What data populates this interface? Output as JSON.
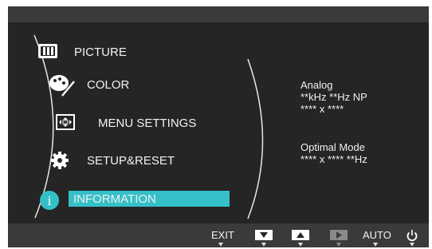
{
  "menu": {
    "items": [
      {
        "label": "PICTURE",
        "icon": "picture-icon"
      },
      {
        "label": "COLOR",
        "icon": "color-palette-icon"
      },
      {
        "label": "MENU SETTINGS",
        "icon": "menu-settings-icon"
      },
      {
        "label": "SETUP&RESET",
        "icon": "gear-icon"
      },
      {
        "label": "INFORMATION",
        "icon": "information-icon",
        "selected": true
      }
    ]
  },
  "info": {
    "signal": "Analog",
    "frequency": "**kHz **Hz NP",
    "resolution": "**** x ****",
    "optimal_label": "Optimal Mode",
    "optimal_value": "**** x ****  **Hz"
  },
  "buttons": {
    "exit_label": "EXIT",
    "down_icon": "down-arrow-icon",
    "up_icon": "up-arrow-icon",
    "right_icon": "right-arrow-icon",
    "auto_label": "AUTO",
    "power_icon": "power-icon"
  },
  "colors": {
    "background": "#252525",
    "bar": "#3a3a3a",
    "highlight": "#35c0c8",
    "text": "#f2f2f2"
  }
}
